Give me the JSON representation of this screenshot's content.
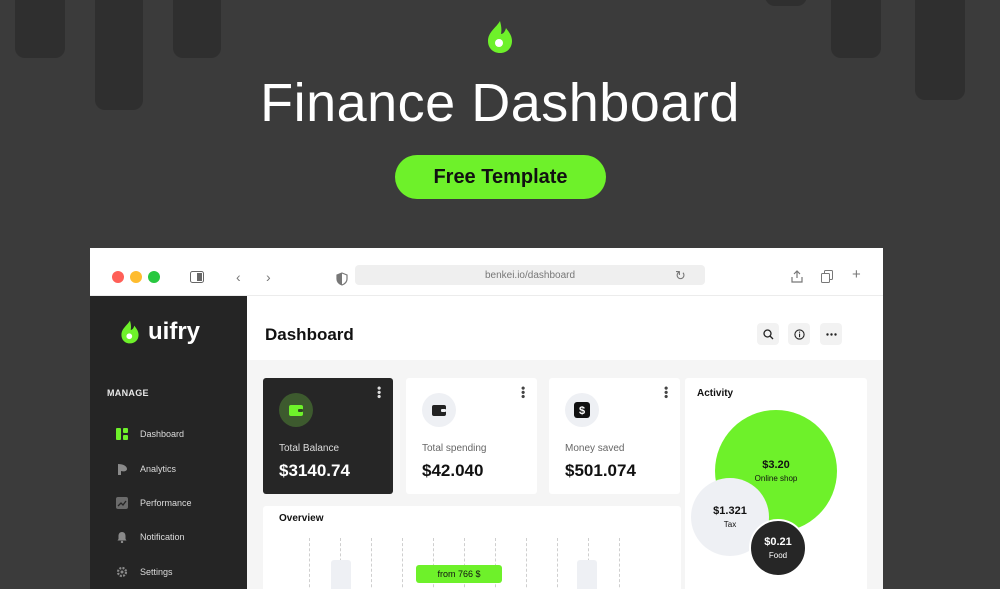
{
  "hero": {
    "title": "Finance Dashboard",
    "cta_label": "Free Template"
  },
  "browser": {
    "url": "benkei.io/dashboard"
  },
  "sidebar": {
    "brand": "uifry",
    "section_label": "MANAGE",
    "items": [
      {
        "label": "Dashboard",
        "icon": "grid-icon"
      },
      {
        "label": "Analytics",
        "icon": "pie-chart-icon"
      },
      {
        "label": "Performance",
        "icon": "chart-icon"
      },
      {
        "label": "Notification",
        "icon": "bell-icon"
      },
      {
        "label": "Settings",
        "icon": "gear-icon"
      }
    ]
  },
  "header": {
    "title": "Dashboard"
  },
  "cards": [
    {
      "label": "Total Balance",
      "value": "$3140.74",
      "icon": "wallet-icon"
    },
    {
      "label": "Total spending",
      "value": "$42.040",
      "icon": "wallet-icon"
    },
    {
      "label": "Money saved",
      "value": "$501.074",
      "icon": "dollar-icon"
    }
  ],
  "overview": {
    "title": "Overview",
    "tooltip": "from 766 $"
  },
  "activity": {
    "title": "Activity",
    "bubbles": [
      {
        "value": "$3.20",
        "label": "Online shop"
      },
      {
        "value": "$1.321",
        "label": "Tax"
      },
      {
        "value": "$0.21",
        "label": "Food"
      }
    ]
  },
  "colors": {
    "accent": "#6ef12a",
    "dark": "#252525",
    "background": "#3b3b3b"
  }
}
